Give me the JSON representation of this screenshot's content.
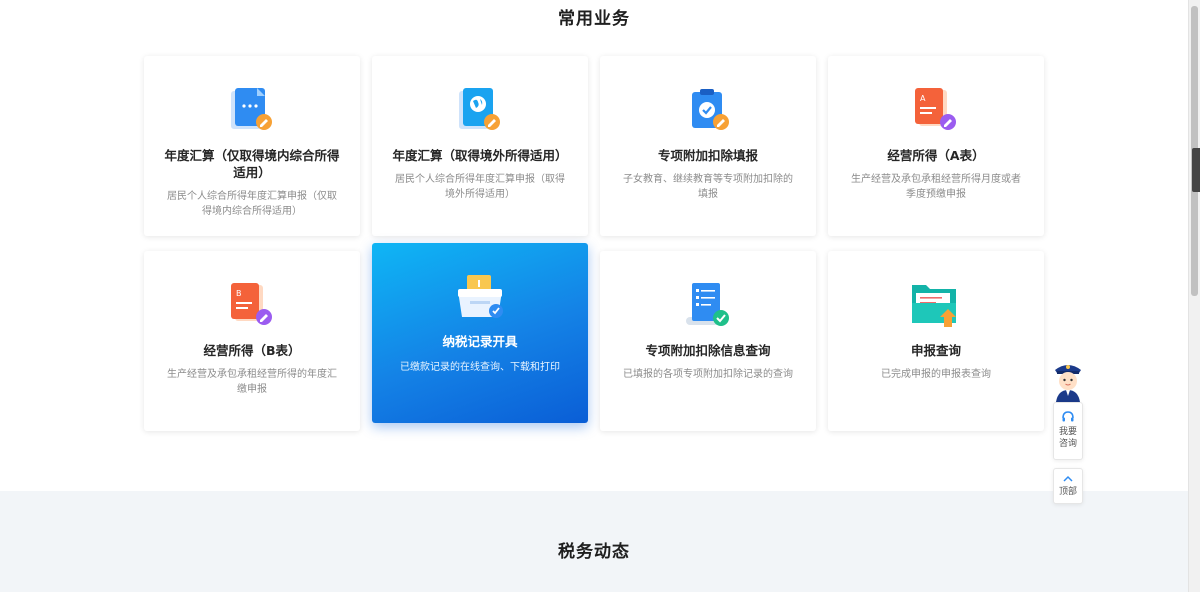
{
  "sections": {
    "common_title": "常用业务",
    "news_title": "税务动态"
  },
  "cards": [
    {
      "title": "年度汇算（仅取得境内综合所得适用）",
      "desc": "居民个人综合所得年度汇算申报（仅取得境内综合所得适用）",
      "icon": "document-edit-icon"
    },
    {
      "title": "年度汇算（取得境外所得适用）",
      "desc": "居民个人综合所得年度汇算申报（取得境外所得适用）",
      "icon": "globe-document-icon"
    },
    {
      "title": "专项附加扣除填报",
      "desc": "子女教育、继续教育等专项附加扣除的填报",
      "icon": "clipboard-check-icon"
    },
    {
      "title": "经营所得（A表）",
      "desc": "生产经营及承包承租经营所得月度或者季度预缴申报",
      "icon": "form-a-icon"
    },
    {
      "title": "经营所得（B表）",
      "desc": "生产经营及承包承租经营所得的年度汇缴申报",
      "icon": "form-b-icon"
    },
    {
      "title": "纳税记录开具",
      "desc": "已缴款记录的在线查询、下载和打印",
      "icon": "tax-record-box-icon"
    },
    {
      "title": "专项附加扣除信息查询",
      "desc": "已填报的各项专项附加扣除记录的查询",
      "icon": "scroll-check-icon"
    },
    {
      "title": "申报查询",
      "desc": "已完成申报的申报表查询",
      "icon": "folder-upload-icon"
    }
  ],
  "helper": {
    "consult_label": "我要咨询",
    "top_label": "顶部"
  },
  "colors": {
    "active_card_start": "#0fb6f5",
    "active_card_end": "#0a5ed6",
    "lower_bg": "#f2f5f8"
  }
}
